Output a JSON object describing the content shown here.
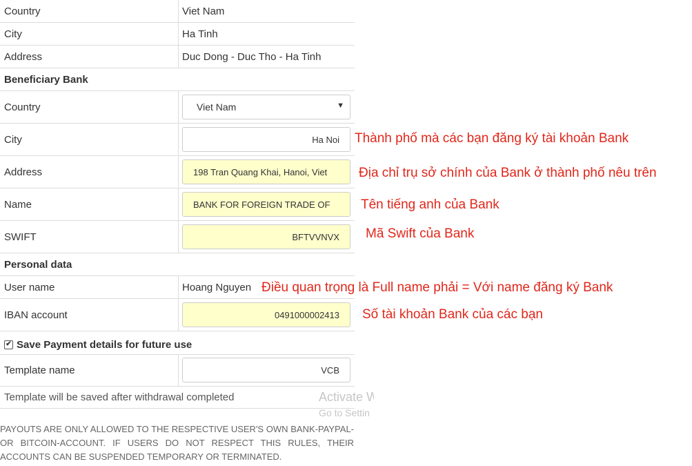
{
  "address_info": {
    "country_label": "Country",
    "country_value": "Viet Nam",
    "city_label": "City",
    "city_value": "Ha Tinh",
    "address_label": "Address",
    "address_value": "Duc Dong - Duc Tho - Ha Tinh"
  },
  "beneficiary_bank": {
    "section_title": "Beneficiary Bank",
    "country_label": "Country",
    "country_selected": "Viet Nam",
    "city_label": "City",
    "city_value": "Ha Noi",
    "address_label": "Address",
    "address_value": "198 Tran Quang Khai, Hanoi, Viet",
    "name_label": "Name",
    "name_value": "BANK FOR FOREIGN TRADE OF",
    "swift_label": "SWIFT",
    "swift_value": "BFTVVNVX"
  },
  "personal_data": {
    "section_title": "Personal data",
    "username_label": "User name",
    "username_value": "Hoang Nguyen",
    "iban_label": "IBAN account",
    "iban_value": "0491000002413"
  },
  "save_payment": {
    "checked": true,
    "label": "Save Payment details for future use"
  },
  "template": {
    "label": "Template name",
    "value": "VCB",
    "info": "Template will be saved after withdrawal completed"
  },
  "annotations": {
    "city": "Thành phố mà các bạn đăng ký tài khoản Bank",
    "address": "Địa chỉ trụ sở chính của Bank ở thành phố nêu trên",
    "name": "Tên tiếng anh của Bank",
    "swift": "Mã Swift của Bank",
    "username": "Điều quan trọng là Full name phải = Với name đăng ký Bank",
    "iban": "Số tài khoản Bank của các bạn"
  },
  "watermark": {
    "line1": "Activate W",
    "line2": "Go to Settin"
  },
  "disclaimer": "PAYOUTS ARE ONLY ALLOWED TO THE RESPECTIVE USER'S OWN BANK-PAYPAL- OR BITCOIN-ACCOUNT. IF USERS DO NOT RESPECT THIS RULES, THEIR ACCOUNTS CAN BE SUSPENDED TEMPORARY OR TERMINATED.",
  "colors": {
    "annotation": "#e0271b",
    "filled_input": "#ffffcc",
    "border": "#dcdcdc",
    "watermark": "#c6c6c6"
  },
  "icons": {
    "select_caret": "caret-down-icon",
    "checkbox": "checkmark-icon"
  }
}
